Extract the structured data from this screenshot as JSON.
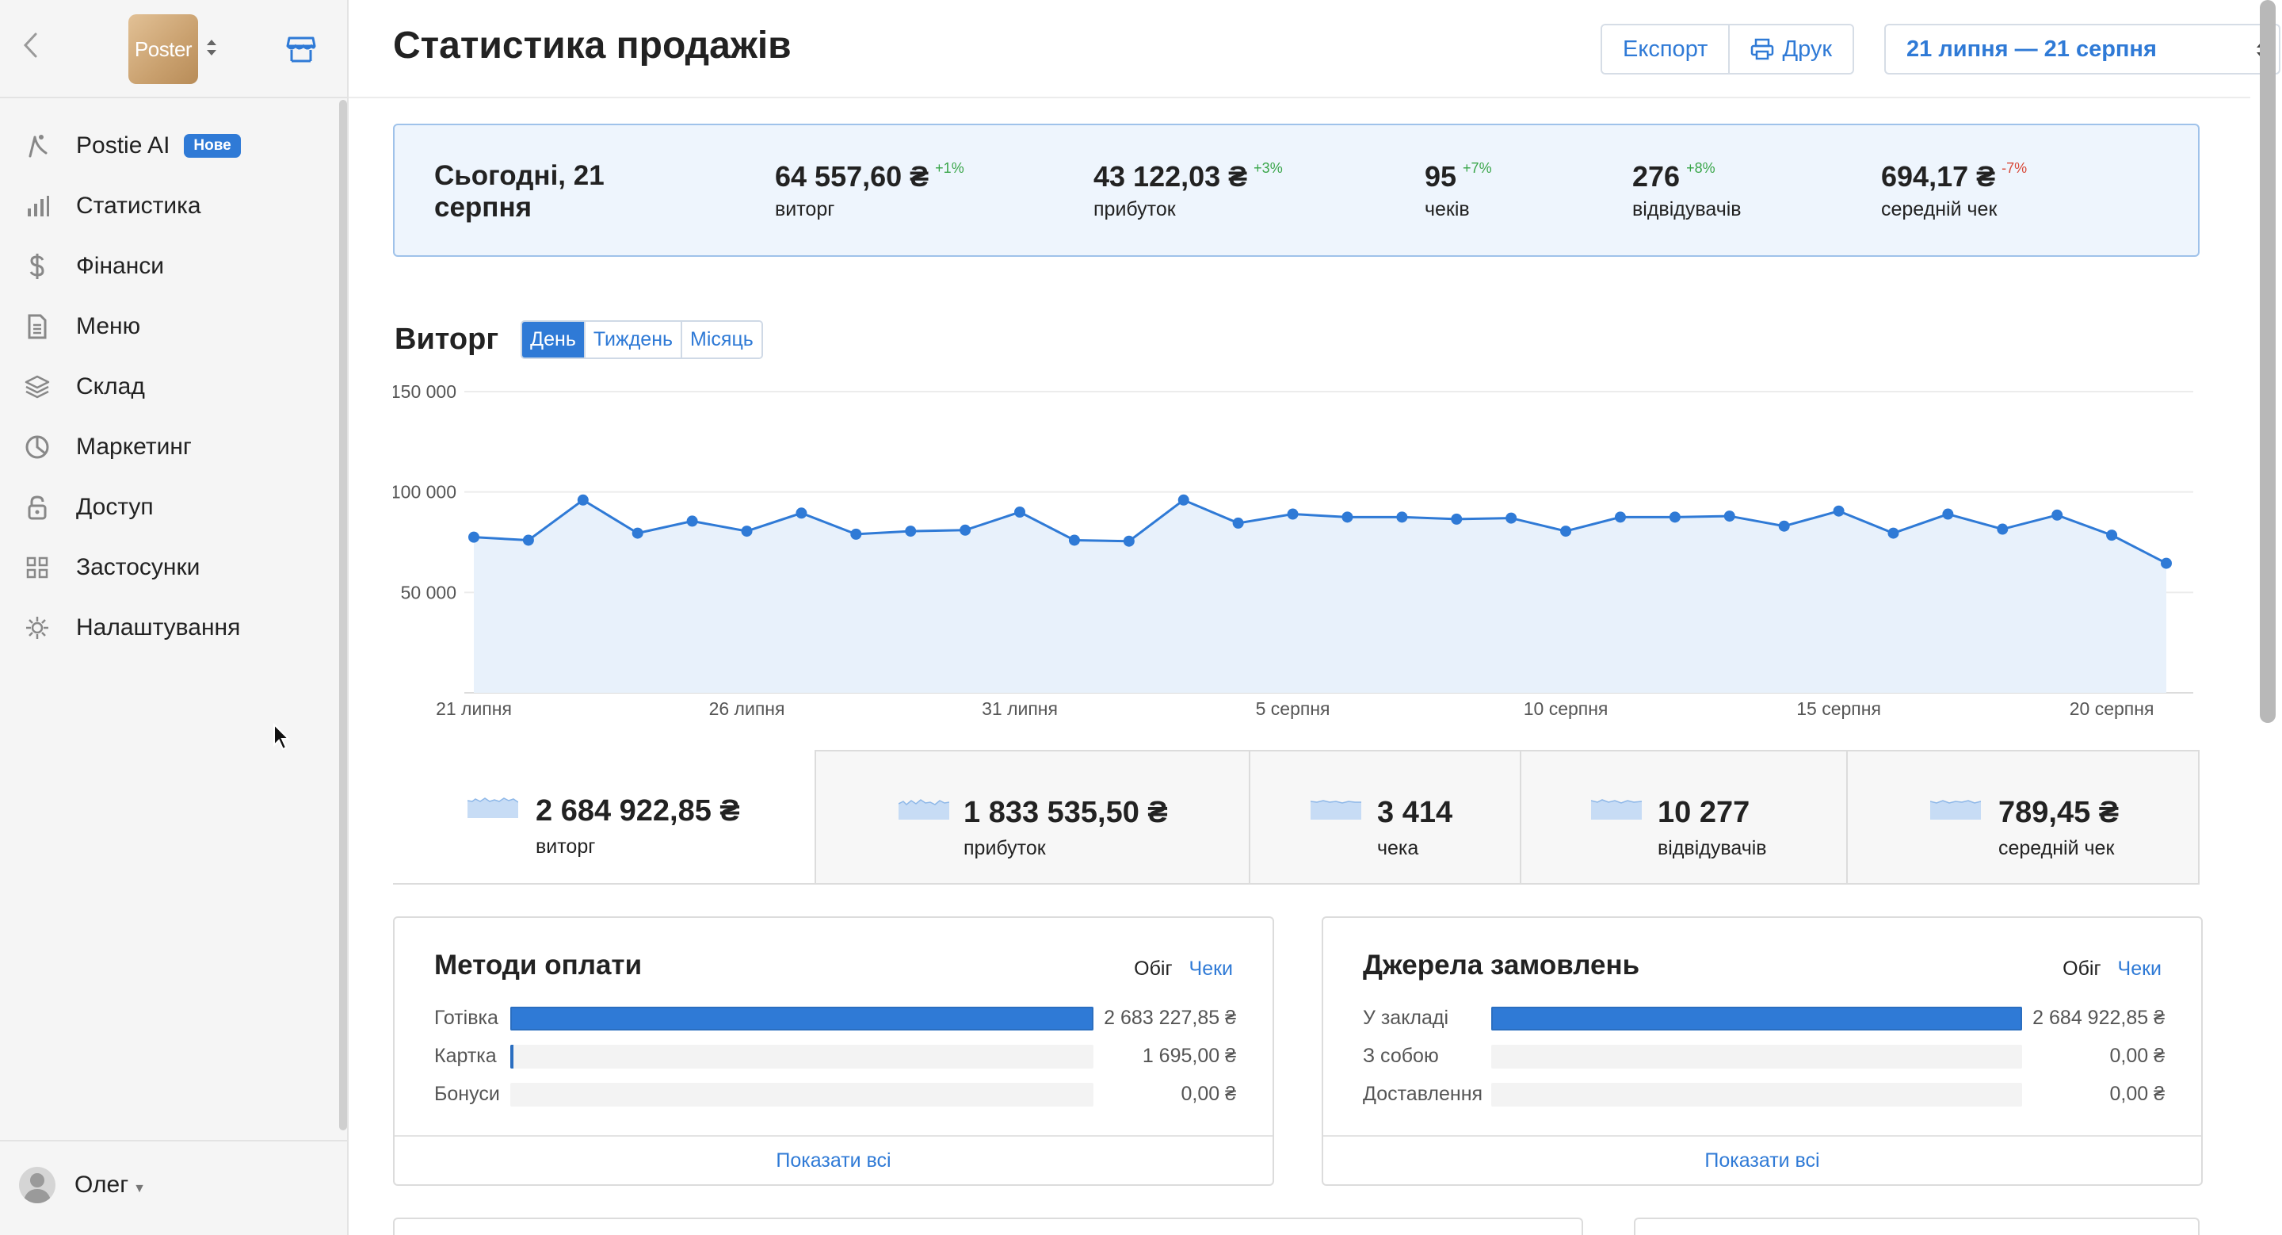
{
  "sidebar": {
    "logo_text": "Poster",
    "items": [
      {
        "label": "Postie AI",
        "badge": "Нове",
        "icon": "sparkle-icon"
      },
      {
        "label": "Статистика",
        "icon": "bar-chart-icon"
      },
      {
        "label": "Фінанси",
        "icon": "dollar-icon"
      },
      {
        "label": "Меню",
        "icon": "document-icon"
      },
      {
        "label": "Склад",
        "icon": "layers-icon"
      },
      {
        "label": "Маркетинг",
        "icon": "pie-chart-icon"
      },
      {
        "label": "Доступ",
        "icon": "lock-icon"
      },
      {
        "label": "Застосунки",
        "icon": "grid-icon"
      },
      {
        "label": "Налаштування",
        "icon": "gear-icon"
      }
    ],
    "user": {
      "name": "Олег"
    }
  },
  "header": {
    "title": "Статистика продажів",
    "export_label": "Експорт",
    "print_label": "Друк",
    "date_range": "21 липня — 21 серпня"
  },
  "today": {
    "title": "Сьогодні, 21 серпня",
    "kpis": [
      {
        "value": "64 557,60 ₴",
        "delta": "+1%",
        "label": "виторг"
      },
      {
        "value": "43 122,03 ₴",
        "delta": "+3%",
        "label": "прибуток"
      },
      {
        "value": "95",
        "delta": "+7%",
        "label": "чеків"
      },
      {
        "value": "276",
        "delta": "+8%",
        "label": "відвідувачів"
      },
      {
        "value": "694,17 ₴",
        "delta": "-7%",
        "label": "середній чек"
      }
    ]
  },
  "revenue": {
    "title": "Виторг",
    "periods": [
      "День",
      "Тиждень",
      "Місяць"
    ],
    "active_period": "День"
  },
  "chart_data": {
    "type": "area",
    "x": [
      "21 липня",
      "22 липня",
      "23 липня",
      "24 липня",
      "25 липня",
      "26 липня",
      "27 липня",
      "28 липня",
      "29 липня",
      "30 липня",
      "31 липня",
      "1 серпня",
      "2 серпня",
      "3 серпня",
      "4 серпня",
      "5 серпня",
      "6 серпня",
      "7 серпня",
      "8 серпня",
      "9 серпня",
      "10 серпня",
      "11 серпня",
      "12 серпня",
      "13 серпня",
      "14 серпня",
      "15 серпня",
      "16 серпня",
      "17 серпня",
      "18 серпня",
      "19 серпня",
      "20 серпня",
      "21 серпня"
    ],
    "tick_labels": [
      "21 липня",
      "26 липня",
      "31 липня",
      "5 серпня",
      "10 серпня",
      "15 серпня",
      "20 серпня"
    ],
    "y_tick_labels": [
      "150 000",
      "100 000",
      "50 000"
    ],
    "series": [
      {
        "values": [
          77500,
          76000,
          96000,
          79500,
          85500,
          80500,
          89500,
          79000,
          80500,
          81000,
          90000,
          76000,
          75500,
          96000,
          84500,
          89000,
          87500,
          87500,
          86500,
          87000,
          80500,
          87500,
          87500,
          88000,
          83000,
          90500,
          79500,
          89000,
          81500,
          88500,
          78500,
          64500
        ]
      }
    ],
    "ylim": [
      0,
      150000
    ],
    "grid": true,
    "color": "#2f7ad6",
    "fill": "#e8f1fb"
  },
  "totals": [
    {
      "value": "2 684 922,85 ₴",
      "label": "виторг"
    },
    {
      "value": "1 833 535,50 ₴",
      "label": "прибуток"
    },
    {
      "value": "3 414",
      "label": "чека"
    },
    {
      "value": "10 277",
      "label": "відвідувачів"
    },
    {
      "value": "789,45 ₴",
      "label": "середній чек"
    }
  ],
  "payment_methods": {
    "title": "Методи оплати",
    "tab_active": "Обіг",
    "tab_other": "Чеки",
    "rows": [
      {
        "label": "Готівка",
        "value": "2 683 227,85 ₴",
        "share": 0.9994
      },
      {
        "label": "Картка",
        "value": "1 695,00 ₴",
        "share": 0.0006
      },
      {
        "label": "Бонуси",
        "value": "0,00 ₴",
        "share": 0
      }
    ],
    "footer": "Показати всі"
  },
  "order_sources": {
    "title": "Джерела замовлень",
    "tab_active": "Обіг",
    "tab_other": "Чеки",
    "rows": [
      {
        "label": "У закладі",
        "value": "2 684 922,85 ₴",
        "share": 1
      },
      {
        "label": "З собою",
        "value": "0,00 ₴",
        "share": 0
      },
      {
        "label": "Доставлення",
        "value": "0,00 ₴",
        "share": 0
      }
    ],
    "footer": "Показати всі"
  },
  "colors": {
    "accent": "#2f7ad6",
    "positive": "#3aa64a",
    "negative": "#d84a3a",
    "highlight_bg": "#eef5fd"
  }
}
